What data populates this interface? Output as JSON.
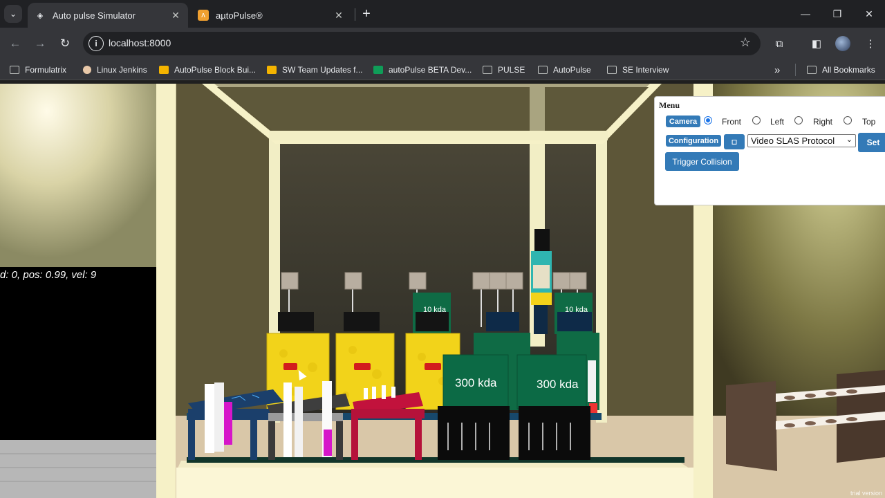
{
  "browser": {
    "tabs": [
      {
        "title": "Auto pulse Simulator",
        "icon": "unity-icon"
      },
      {
        "title": "aµtoPulse®",
        "icon": "autopulse-icon"
      }
    ],
    "url": "localhost:8000",
    "bookmarks": [
      {
        "label": "Formulatrix",
        "icon": "folder-icon"
      },
      {
        "label": "Linux Jenkins",
        "icon": "jenkins-icon"
      },
      {
        "label": "AutoPulse Block Bui...",
        "icon": "slides-icon"
      },
      {
        "label": "SW Team Updates f...",
        "icon": "slides-icon"
      },
      {
        "label": "autoPulse BETA Dev...",
        "icon": "sheets-icon"
      },
      {
        "label": "PULSE",
        "icon": "folder-icon"
      },
      {
        "label": "AutoPulse",
        "icon": "folder-icon"
      },
      {
        "label": "SE Interview",
        "icon": "folder-icon"
      }
    ],
    "all_bookmarks_label": "All Bookmarks",
    "overflow_label": "»"
  },
  "scene": {
    "status_text": "d: 0, pos: 0.99, vel: 9",
    "labels": {
      "kda_small": "10 kda",
      "kda_big": "300 kda"
    },
    "watermark": "trial version"
  },
  "menu": {
    "title": "Menu",
    "camera_label": "Camera",
    "camera_options": [
      "Front",
      "Left",
      "Right",
      "Top"
    ],
    "camera_selected": "Front",
    "configuration_label": "Configuration",
    "config_toggle_glyph": "◻",
    "protocol_value": "Video SLAS Protocol",
    "set_label": "Set",
    "trigger_label": "Trigger Collision"
  },
  "colors": {
    "accent": "#337ab7",
    "yellow_block": "#f2d31a",
    "green_block": "#0f6b45",
    "red_block": "#b5123a",
    "navy_block": "#1b3f6b",
    "magenta_tube": "#d616c9"
  }
}
